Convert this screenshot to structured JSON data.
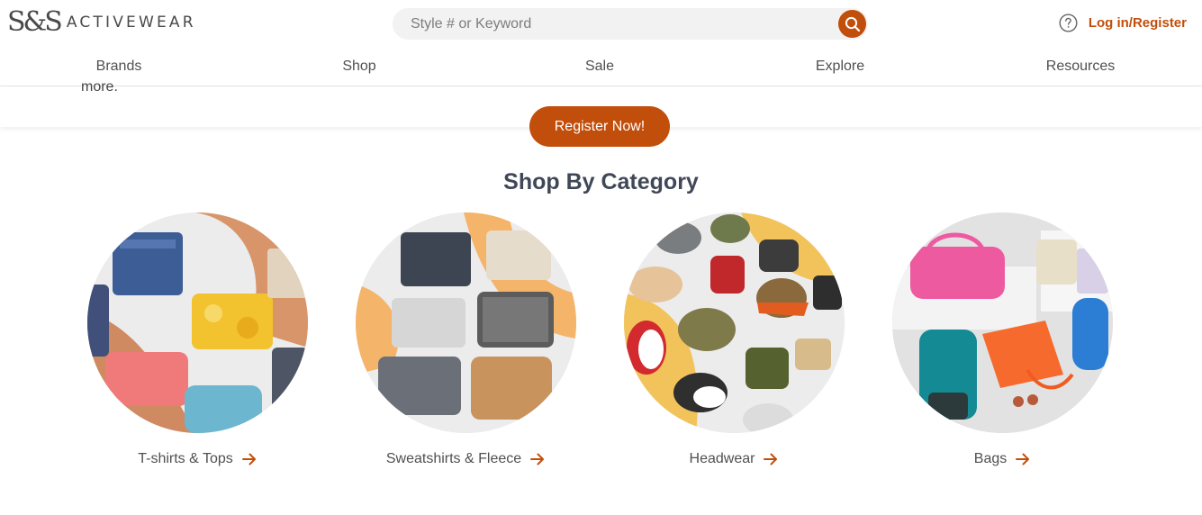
{
  "header": {
    "logo_mark": "S&S",
    "logo_text": "ACTIVEWEAR",
    "search_placeholder": "Style # or Keyword",
    "login_label": "Log in/Register"
  },
  "nav": {
    "items": [
      "Brands",
      "Shop",
      "Sale",
      "Explore",
      "Resources"
    ]
  },
  "promo": {
    "cut_text": "more.",
    "register_label": "Register Now!"
  },
  "categories": {
    "title": "Shop By Category",
    "items": [
      {
        "label": "T-shirts & Tops"
      },
      {
        "label": "Sweatshirts & Fleece"
      },
      {
        "label": "Headwear"
      },
      {
        "label": "Bags"
      }
    ]
  },
  "colors": {
    "accent": "#c24e0b",
    "title": "#404858",
    "text": "#505050"
  }
}
